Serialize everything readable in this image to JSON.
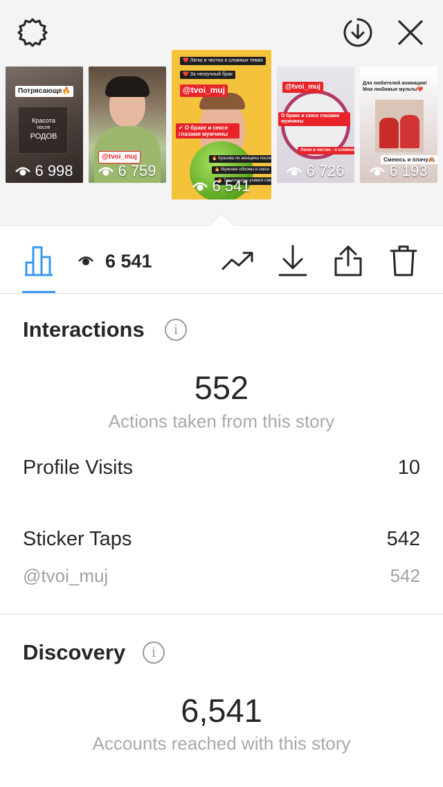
{
  "header": {
    "settings_icon": "gear-icon",
    "download_icon": "circle-download-icon",
    "close_icon": "close-icon"
  },
  "stories": [
    {
      "views": "6 998",
      "captions": [
        "Потрясающе🔥",
        "Красота",
        "после",
        "РОДОВ"
      ]
    },
    {
      "views": "6 759",
      "captions": [
        "@tvoi_muj"
      ]
    },
    {
      "views": "6 541",
      "captions": [
        "❤️ Легко и честно о сложных темах",
        "❤️ За нескучный брак",
        "@tvoi_muj",
        "✔ О браке и сексе глазами мужчины",
        "🔥 Красива ли женщина после родов",
        "🔥 Мужские обломы в сексе",
        "🔥 Так плохо/но учимся говорить"
      ]
    },
    {
      "views": "6 726",
      "captions": [
        "@tvoi_muj",
        "О браке и сексе глазами мужчины",
        "Легко и честно - о сложном"
      ]
    },
    {
      "views": "6 193",
      "captions": [
        "Для любителей анимации! Мои любимые мульты❤️",
        "Смеюсь и плачу🙈"
      ]
    }
  ],
  "toolbar": {
    "insights_icon": "bar-chart-icon",
    "eye_icon": "eye-icon",
    "view_count": "6 541",
    "trend_icon": "trending-up-icon",
    "download_icon": "download-icon",
    "share_icon": "share-icon",
    "delete_icon": "trash-icon"
  },
  "interactions": {
    "title": "Interactions",
    "total": "552",
    "subtitle": "Actions taken from this story",
    "profile_visits_label": "Profile Visits",
    "profile_visits_value": "10",
    "sticker_taps_label": "Sticker Taps",
    "sticker_taps_value": "542",
    "sticker_handle": "@tvoi_muj",
    "sticker_handle_value": "542"
  },
  "discovery": {
    "title": "Discovery",
    "total": "6,541",
    "subtitle": "Accounts reached with this story"
  },
  "colors": {
    "accent": "#3897f0",
    "story_tag_red": "#e8242a",
    "muted_text": "#a8a8a8"
  }
}
